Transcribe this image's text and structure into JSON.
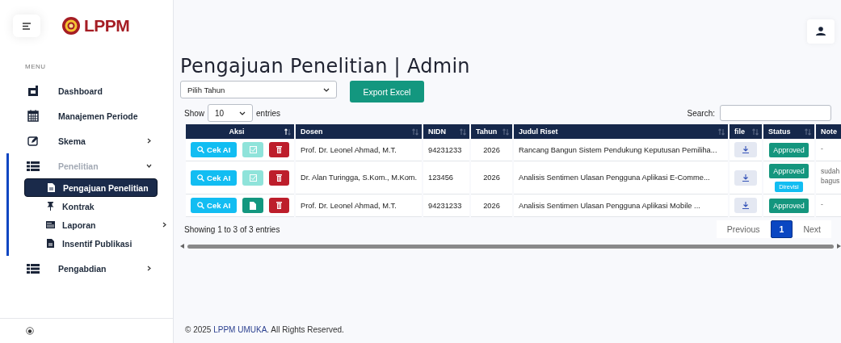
{
  "sidebar": {
    "logo_text": "LPPM",
    "menu_label": "MENU",
    "items": [
      {
        "label": "Dashboard"
      },
      {
        "label": "Manajemen Periode"
      },
      {
        "label": "Skema",
        "expanded": false
      },
      {
        "label": "Penelitian",
        "expanded": true,
        "children": [
          {
            "label": "Pengajuan Penelitian",
            "selected": true
          },
          {
            "label": "Kontrak",
            "selected": false
          },
          {
            "label": "Laporan",
            "selected": false,
            "expanded": false
          },
          {
            "label": "Insentif Publikasi",
            "selected": false
          }
        ]
      },
      {
        "label": "Pengabdian",
        "expanded": false
      }
    ]
  },
  "page": {
    "title": "Pengajuan Penelitian | Admin",
    "year_select": {
      "value": "Pilih Tahun"
    },
    "export_button": "Export Excel",
    "show_label": "Show",
    "page_size": "10",
    "entries_label": "entries",
    "search": {
      "label": "Search:"
    }
  },
  "table": {
    "columns": [
      {
        "label": "Aksi",
        "sorted": true
      },
      {
        "label": "Dosen",
        "sorted": false
      },
      {
        "label": "NIDN",
        "sorted": false
      },
      {
        "label": "Tahun",
        "sorted": false
      },
      {
        "label": "Judul Riset",
        "sorted": false
      },
      {
        "label": "file",
        "sorted": false
      },
      {
        "label": "Status",
        "sorted": false
      },
      {
        "label": "Note"
      }
    ],
    "rows": [
      {
        "ai_button": "Cek AI",
        "action": {
          "kind": "verify",
          "disabled": true
        },
        "dosen": "Prof. Dr. Leonel Ahmad, M.T.",
        "nidn": "94231233",
        "tahun": "2026",
        "judul": "Rancang Bangun Sistem Pendukung Keputusan Pemiliha...",
        "status": [
          {
            "label": "Approved",
            "kind": "approved"
          }
        ],
        "note": "-"
      },
      {
        "ai_button": "Cek AI",
        "action": {
          "kind": "verify",
          "disabled": true
        },
        "dosen": "Dr. Alan Turingga, S.Kom., M.Kom.",
        "nidn": "123456",
        "tahun": "2026",
        "judul": "Analisis Sentimen Ulasan Pengguna Aplikasi E-Comme...",
        "status": [
          {
            "label": "Approved",
            "kind": "approved"
          },
          {
            "label": "Direvisi",
            "kind": "revised"
          }
        ],
        "note": "sudah bagus"
      },
      {
        "ai_button": "Cek AI",
        "action": {
          "kind": "document",
          "disabled": false
        },
        "dosen": "Prof. Dr. Leonel Ahmad, M.T.",
        "nidn": "94231233",
        "tahun": "2026",
        "judul": "Analisis Sentimen Ulasan Pengguna Aplikasi Mobile ...",
        "status": [
          {
            "label": "Approved",
            "kind": "approved"
          }
        ],
        "note": "-"
      }
    ]
  },
  "info": "Showing 1 to 3 of 3 entries",
  "pagination": [
    {
      "label": "Previous",
      "selected": false
    },
    {
      "label": "1",
      "selected": true
    },
    {
      "label": "Next",
      "selected": false
    }
  ],
  "footer": {
    "before": "© 2025 ",
    "link": "LPPM UMUKA",
    "after": ". All Rights Reserved."
  }
}
